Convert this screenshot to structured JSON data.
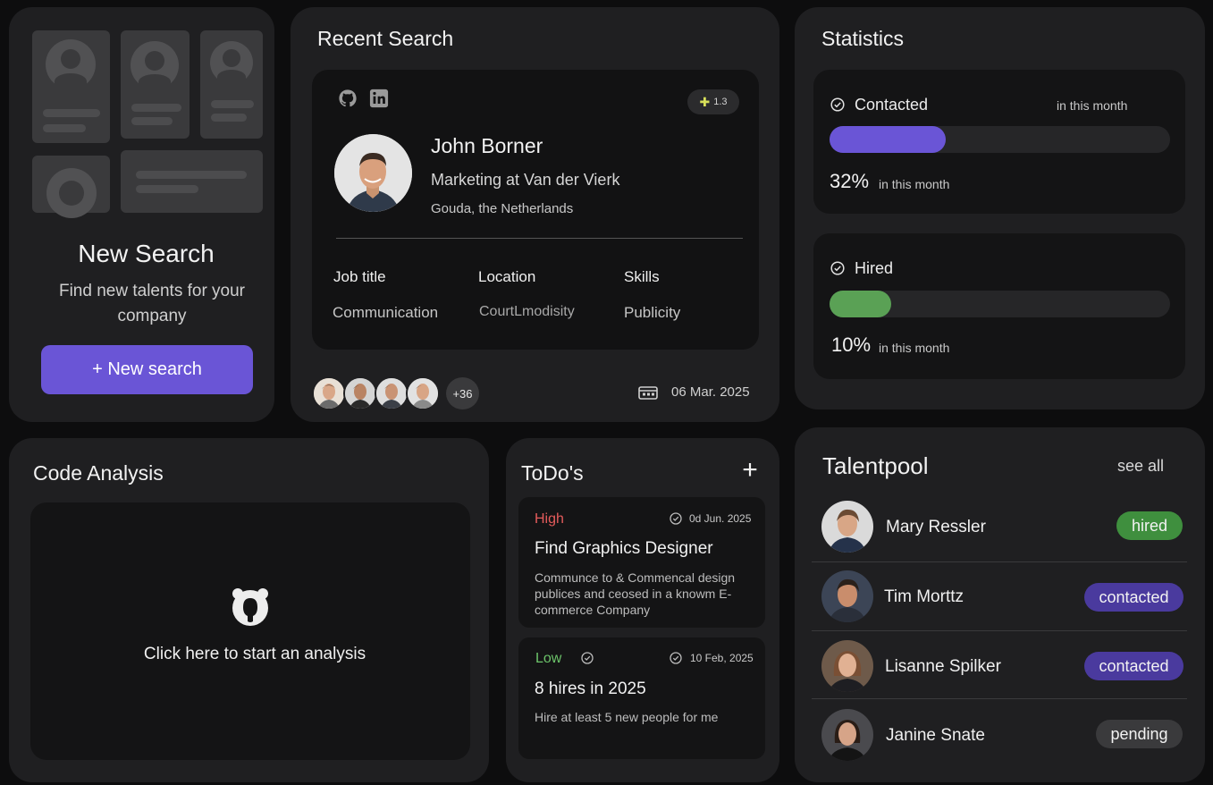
{
  "new_search": {
    "title": "New Search",
    "subtitle": "Find new talents for your company",
    "button_label": "+ New search"
  },
  "recent_search": {
    "title": "Recent Search",
    "profile": {
      "name": "John Borner",
      "role": "Marketing at Van der Vierk",
      "location": "Gouda, the Netherlands",
      "score": "1.3",
      "columns": [
        {
          "label": "Job title",
          "value": "Communication"
        },
        {
          "label": "Location",
          "value": "CourtLmodisity"
        },
        {
          "label": "Skills",
          "value": "Publicity"
        }
      ]
    },
    "extra_count": "+36",
    "date": "06 Mar. 2025"
  },
  "statistics": {
    "title": "Statistics",
    "items": [
      {
        "label": "Contacted",
        "note": "in this month",
        "percent_text": "32%",
        "percent_note": "in this month",
        "fill": 0.34,
        "color": "#6a55d6"
      },
      {
        "label": "Hired",
        "percent_text": "10%",
        "percent_note": "in this month",
        "fill": 0.18,
        "color": "#5aa155"
      }
    ]
  },
  "code_analysis": {
    "title": "Code Analysis",
    "prompt": "Click here to start an analysis"
  },
  "todos": {
    "title": "ToDo's",
    "add_label": "+",
    "items": [
      {
        "priority": "High",
        "priority_color": "#e45b5b",
        "date": "0d Jun. 2025",
        "title": "Find Graphics Designer",
        "desc": "Communce to & Commencal design publices and ceosed in a knowm E-commerce Company"
      },
      {
        "priority": "Low",
        "priority_color": "#6cc46a",
        "date": "10 Feb, 2025",
        "title": "8 hires in 2025",
        "desc": "Hire at least 5 new people for me"
      }
    ]
  },
  "talentpool": {
    "title": "Talentpool",
    "see_all": "see all",
    "people": [
      {
        "name": "Mary Ressler",
        "status": "hired",
        "status_color": "#3f8f3e"
      },
      {
        "name": "Tim Morttz",
        "status": "contacted",
        "status_color": "#4a3a9e"
      },
      {
        "name": "Lisanne Spilker",
        "status": "contacted",
        "status_color": "#4a3a9e"
      },
      {
        "name": "Janine Snate",
        "status": "pending",
        "status_color": "#3a3a3c"
      }
    ]
  }
}
